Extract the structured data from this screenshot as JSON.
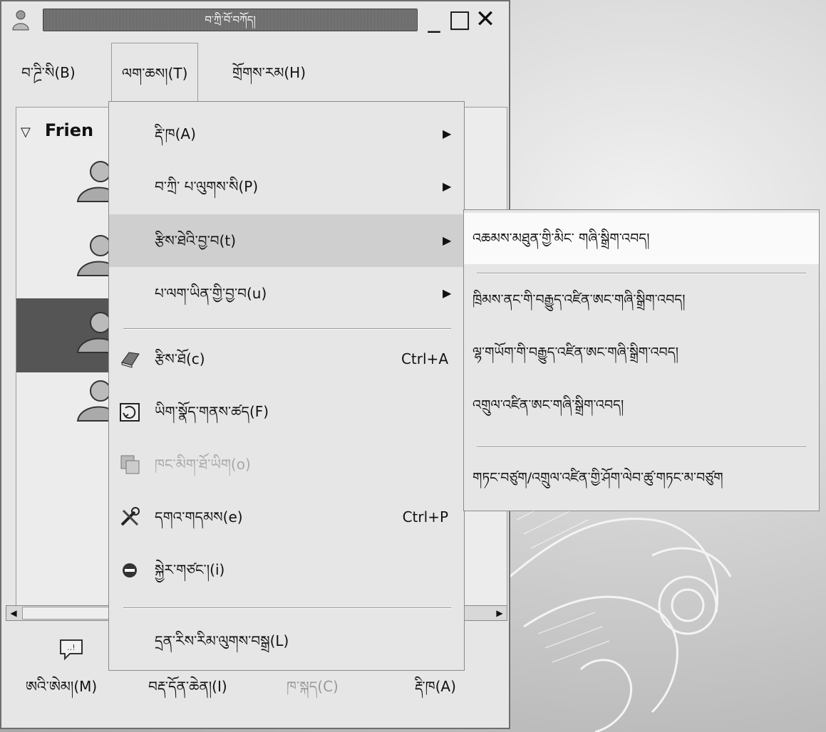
{
  "window": {
    "title": "བ་ཀྲི་བོ་བཀོད།",
    "min_glyph": "_",
    "max_glyph": "□",
    "close_glyph": "✕"
  },
  "menubar": {
    "items": [
      {
        "label": "བ་ཌྲི་སི(B)"
      },
      {
        "label": "ལག་ཆས།(T)"
      },
      {
        "label": "གྲོགས་རམ(H)"
      }
    ]
  },
  "tree": {
    "group_label": "Frien",
    "expander": "▽"
  },
  "scrollbar": {
    "left_arrow": "◀",
    "right_arrow": "▶"
  },
  "bottom": {
    "buttons": [
      {
        "label": "ཨའི་ཨེམ།(M)",
        "enabled": true
      },
      {
        "label": "བརྡ་དོན་ཆེན།(I)",
        "enabled": true
      },
      {
        "label": "ཁ་སྐད(C)",
        "enabled": false
      },
      {
        "label": "རྡི་ཁ(A)",
        "enabled": true
      }
    ]
  },
  "dropdown": {
    "items": [
      {
        "label": "རྡི་ཁ(A)",
        "submenu": true
      },
      {
        "label": "བ་ཀྲི་ པ་ལུགས་སི(P)",
        "submenu": true
      },
      {
        "label": "རྩིས་ཐེའི་བྱ་བ(t)",
        "submenu": true,
        "highlighted": true
      },
      {
        "label": "པ་ལག་ཡིན་གྱི་བྱ་བ(u)",
        "submenu": true
      },
      {
        "label": "རྩིས་ཐོ(c)",
        "accel": "Ctrl+A",
        "icon": "book-icon"
      },
      {
        "label": "ཡིག་སྣོད་གནས་ཚད(F)",
        "icon": "file-transfer-icon"
      },
      {
        "label": "ཁང་མིག་ཐོ་ཡིག(o)",
        "icon": "room-list-icon",
        "disabled": true
      },
      {
        "label": "དགའ་གདམས(e)",
        "accel": "Ctrl+P",
        "icon": "tools-icon"
      },
      {
        "label": "སྐྱེར་གཙང་།(i)",
        "icon": "disconnect-icon"
      },
      {
        "label": "དྲན་རིས་རིམ་ལུགས་བསྒྲ(L)"
      }
    ]
  },
  "submenu": {
    "items": [
      {
        "label": "འཆམས་མཐུན་གྱི་མིང་ གཞི་སྒྲིག་འབད།",
        "highlighted": true
      },
      {
        "label": "ཁྲིམས་ནང་གི་བརྒྱུད་འཛིན་ཨང་གཞི་སྒྲིག་འབད།"
      },
      {
        "label": "ལྷ་གཡོག་གི་བརྒྱུད་འཛིན་ཨང་གཞི་སྒྲིག་འབད།"
      },
      {
        "label": "འགྲུལ་འཛིན་ཨང་གཞི་སྒྲིག་འབད།"
      },
      {
        "label": "གཏང་བཙུག/འགྲུལ་འཛིན་གྱི་ཤོག་ལེབ་ཚུ་གཏང་མ་བཙུག"
      }
    ]
  }
}
